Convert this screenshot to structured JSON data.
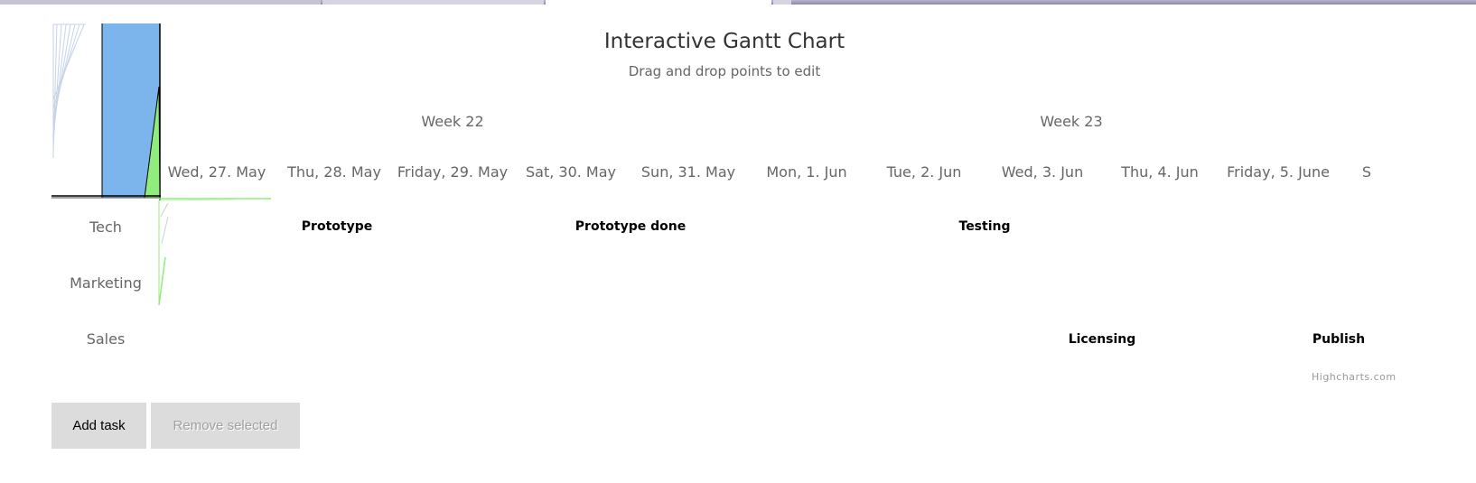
{
  "title": "Interactive Gantt Chart",
  "subtitle": "Drag and drop points to edit",
  "weeks": [
    "Week 22",
    "Week 23"
  ],
  "days": [
    "Wed, 27. May",
    "Thu, 28. May",
    "Friday, 29. May",
    "Sat, 30. May",
    "Sun, 31. May",
    "Mon, 1. Jun",
    "Tue, 2. Jun",
    "Wed, 3. Jun",
    "Thu, 4. Jun",
    "Friday, 5. June",
    "S"
  ],
  "categories": [
    "Tech",
    "Marketing",
    "Sales"
  ],
  "tasks": [
    {
      "name": "Prototype",
      "category": "Tech"
    },
    {
      "name": "Prototype done",
      "category": "Tech"
    },
    {
      "name": "Testing",
      "category": "Tech"
    },
    {
      "name": "Licensing",
      "category": "Sales"
    },
    {
      "name": "Publish",
      "category": "Sales"
    }
  ],
  "credits": "Highcharts.com",
  "buttons": {
    "add": "Add task",
    "remove": "Remove selected"
  },
  "colors": {
    "bar_blue": "#7cb5ec",
    "bar_green": "#90ed7d",
    "disabled_text": "#a0a0a0",
    "button_bg": "#dcdcdc"
  }
}
